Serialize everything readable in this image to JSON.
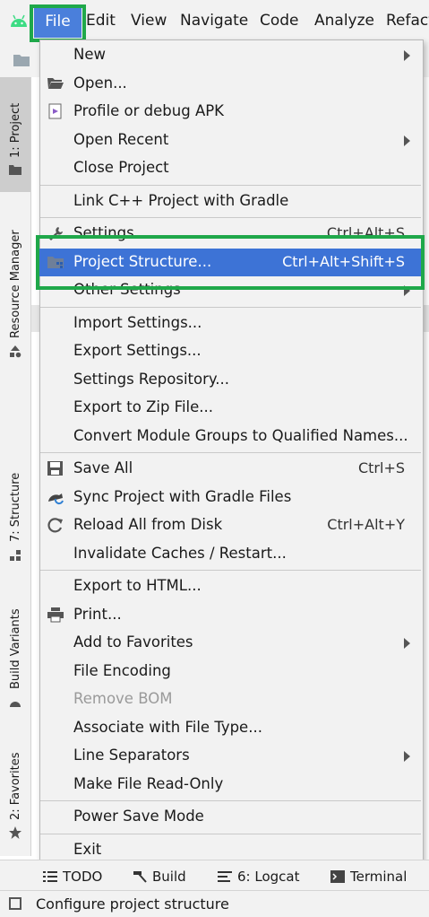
{
  "menubar": {
    "items": [
      "File",
      "Edit",
      "View",
      "Navigate",
      "Code",
      "Analyze",
      "Refact"
    ]
  },
  "left_tabs": [
    "1: Project",
    "Resource Manager",
    "7: Structure",
    "Build Variants",
    "2: Favorites"
  ],
  "menu": {
    "groups": [
      [
        {
          "label": "New",
          "submenu": true
        },
        {
          "label": "Open...",
          "icon": "folder-open-icon"
        },
        {
          "label": "Profile or debug APK",
          "icon": "apk-icon"
        },
        {
          "label": "Open Recent",
          "submenu": true
        },
        {
          "label": "Close Project"
        }
      ],
      [
        {
          "label": "Link C++ Project with Gradle"
        }
      ],
      [
        {
          "label": "Settings...",
          "shortcut": "Ctrl+Alt+S",
          "icon": "wrench-icon"
        },
        {
          "label": "Project Structure...",
          "shortcut": "Ctrl+Alt+Shift+S",
          "icon": "project-structure-icon",
          "selected": true
        },
        {
          "label": "Other Settings",
          "submenu": true
        }
      ],
      [
        {
          "label": "Import Settings..."
        },
        {
          "label": "Export Settings..."
        },
        {
          "label": "Settings Repository..."
        },
        {
          "label": "Export to Zip File..."
        },
        {
          "label": "Convert Module Groups to Qualified Names..."
        }
      ],
      [
        {
          "label": "Save All",
          "shortcut": "Ctrl+S",
          "icon": "save-icon"
        },
        {
          "label": "Sync Project with Gradle Files",
          "icon": "gradle-sync-icon"
        },
        {
          "label": "Reload All from Disk",
          "shortcut": "Ctrl+Alt+Y",
          "icon": "reload-icon"
        },
        {
          "label": "Invalidate Caches / Restart..."
        }
      ],
      [
        {
          "label": "Export to HTML..."
        },
        {
          "label": "Print...",
          "icon": "printer-icon"
        },
        {
          "label": "Add to Favorites",
          "submenu": true
        },
        {
          "label": "File Encoding"
        },
        {
          "label": "Remove BOM",
          "disabled": true
        },
        {
          "label": "Associate with File Type..."
        },
        {
          "label": "Line Separators",
          "submenu": true
        },
        {
          "label": "Make File Read-Only"
        }
      ],
      [
        {
          "label": "Power Save Mode"
        }
      ],
      [
        {
          "label": "Exit"
        }
      ]
    ]
  },
  "bottom_tabs": [
    "TODO",
    "Build",
    "6: Logcat",
    "Terminal"
  ],
  "status_bar": {
    "text": "Configure project structure"
  },
  "colors": {
    "selection": "#3d73d6",
    "highlight_box": "#1fa84a",
    "menu_bg": "#f2f2f2"
  }
}
